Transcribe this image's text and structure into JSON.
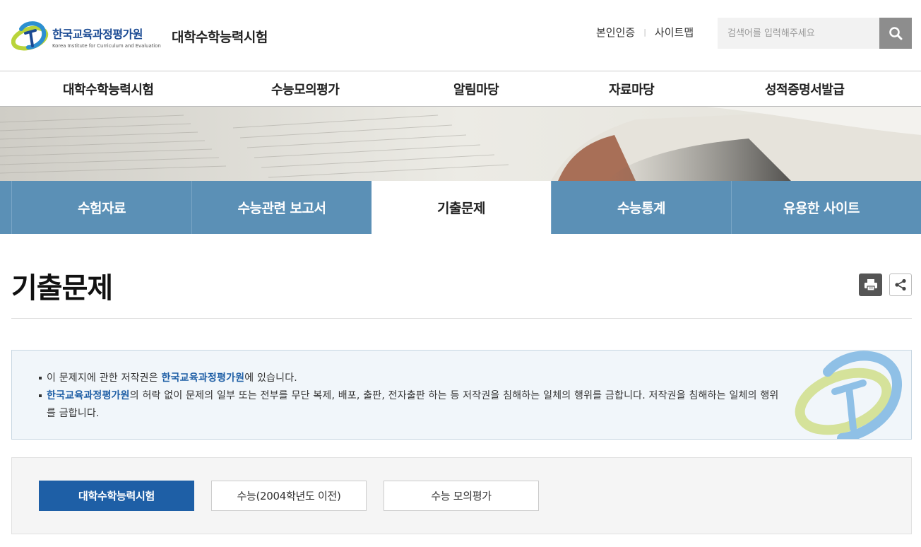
{
  "header": {
    "logo_kr": "한국교육과정평가원",
    "logo_en": "Korea Institute for Curriculum and Evaluation",
    "site_name": "대학수학능력시험",
    "util_links": [
      "본인인증",
      "사이트맵"
    ],
    "search_placeholder": "검색어를 입력해주세요"
  },
  "gnb": {
    "items": [
      "대학수학능력시험",
      "수능모의평가",
      "알림마당",
      "자료마당",
      "성적증명서발급"
    ]
  },
  "subtabs": {
    "items": [
      "수험자료",
      "수능관련 보고서",
      "기출문제",
      "수능통계",
      "유용한 사이트"
    ],
    "active_index": 2
  },
  "page": {
    "title": "기출문제"
  },
  "notice": {
    "line1_pre": "이 문제지에 관한 저작권은 ",
    "line1_hl": "한국교육과정평가원",
    "line1_post": "에 있습니다.",
    "line2_hl": "한국교육과정평가원",
    "line2_post": "의 허락 없이 문제의 일부 또는 전부를 무단 복제, 배포, 출판, 전자출판 하는 등 저작권을 침해하는 일체의 행위를 금합니다. 저작권을 침해하는 일체의 행위를 금합니다."
  },
  "filter": {
    "tabs": [
      "대학수학능력시험",
      "수능(2004학년도 이전)",
      "수능 모의평가"
    ],
    "active_index": 0
  },
  "colors": {
    "brand_blue": "#1e5fa6",
    "subtab_blue": "#5b90b6",
    "highlight": "#1f5fa6"
  }
}
